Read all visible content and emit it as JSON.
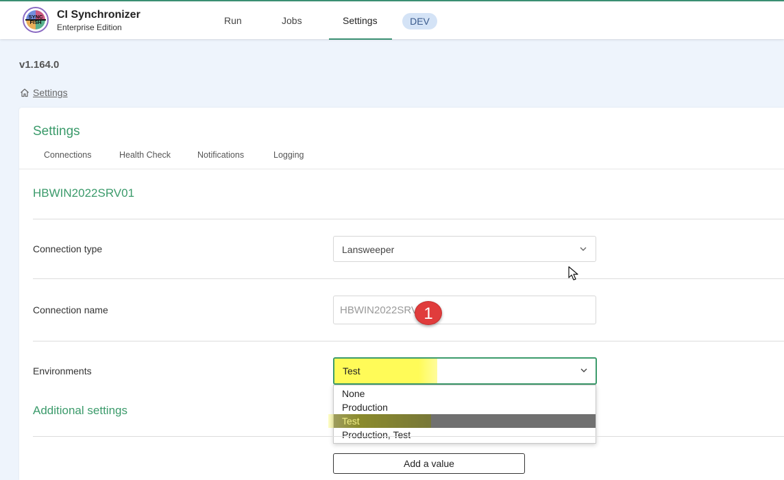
{
  "app": {
    "logo_line1": "SYNC",
    "logo_line2": "FISH",
    "name": "CI Synchronizer",
    "edition": "Enterprise Edition"
  },
  "nav": {
    "tabs": [
      {
        "label": "Run",
        "active": false
      },
      {
        "label": "Jobs",
        "active": false
      },
      {
        "label": "Settings",
        "active": true
      }
    ],
    "env_badge": "DEV"
  },
  "version": "v1.164.0",
  "breadcrumb": {
    "label": "Settings",
    "icon": "home-icon"
  },
  "card": {
    "title": "Settings",
    "subtabs": [
      "Connections",
      "Health Check",
      "Notifications",
      "Logging"
    ],
    "connection_title": "HBWIN2022SRV01",
    "fields": {
      "connection_type": {
        "label": "Connection type",
        "value": "Lansweeper"
      },
      "connection_name": {
        "label": "Connection name",
        "value": "HBWIN2022SRV01"
      },
      "environments": {
        "label": "Environments",
        "value": "Test"
      }
    },
    "environment_options": [
      "None",
      "Production",
      "Test",
      "Production, Test"
    ],
    "selected_option_index": 2,
    "additional_settings_title": "Additional settings",
    "add_value_label": "Add a value"
  },
  "annotation": {
    "marker_number": "1"
  },
  "colors": {
    "accent_green": "#3a9a6a",
    "highlight_yellow": "#fffb58",
    "marker_red": "#e03c3c",
    "badge_blue": "#d4e3f6"
  }
}
